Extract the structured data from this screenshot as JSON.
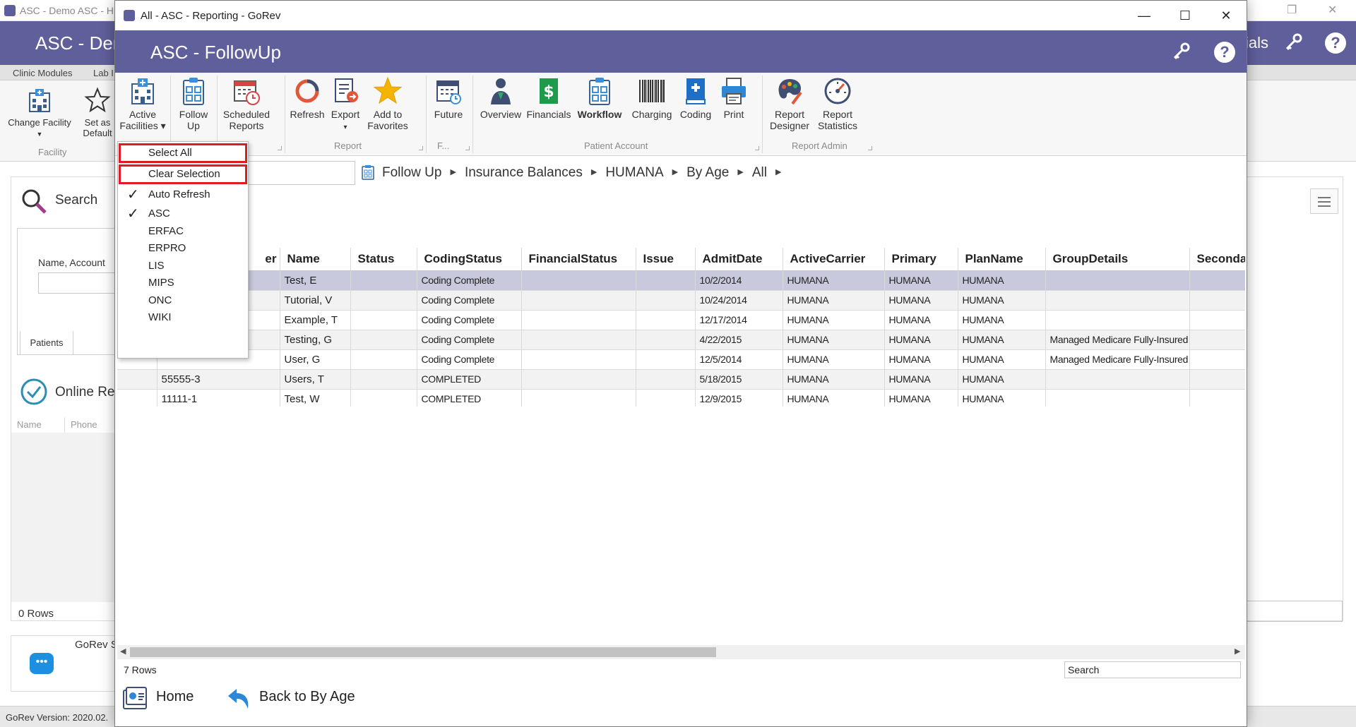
{
  "background_app": {
    "title": "ASC - Demo ASC - H",
    "brand": "ASC - Der",
    "right_text": "ials",
    "menubar": [
      "Clinic Modules",
      "Lab I"
    ],
    "ribbon": {
      "change_facility": "Change Facility",
      "set_as_default_1": "Set as",
      "set_as_default_2": "Default",
      "group_facility": "Facility"
    },
    "left_panel": {
      "search": "Search",
      "name_label": "Name, Account",
      "patients_tab": "Patients",
      "online": "Online Re",
      "col_name": "Name",
      "col_phone": "Phone",
      "rows": "0 Rows"
    },
    "chat_label": "GoRev S",
    "version": "GoRev Version: 2020.02."
  },
  "window": {
    "title": "All - ASC - Reporting - GoRev",
    "minimize": "—",
    "maximize": "☐",
    "close": "✕"
  },
  "header": {
    "brand": "ASC - FollowUp"
  },
  "ribbon": {
    "active_facilities_1": "Active",
    "active_facilities_2": "Facilities ▾",
    "follow_up_1": "Follow",
    "follow_up_2": "Up",
    "scheduled_reports_1": "Scheduled",
    "scheduled_reports_2": "Reports",
    "refresh": "Refresh",
    "export": "Export",
    "export_arrow": "▾",
    "add_fav_1": "Add to",
    "add_fav_2": "Favorites",
    "future": "Future",
    "overview": "Overview",
    "financials": "Financials",
    "workflow": "Workflow",
    "charging": "Charging",
    "coding": "Coding",
    "print": "Print",
    "report_designer_1": "Report",
    "report_designer_2": "Designer",
    "report_statistics_1": "Report",
    "report_statistics_2": "Statistics",
    "group_report": "Report",
    "group_f": "F...",
    "group_patient_account": "Patient Account",
    "group_report_admin": "Report Admin"
  },
  "breadcrumb": [
    "Follow Up",
    "Insurance Balances",
    "HUMANA",
    "By Age",
    "All"
  ],
  "dropdown": {
    "select_all": "Select All",
    "clear_selection": "Clear Selection",
    "auto_refresh": "Auto Refresh",
    "check": "✓",
    "facilities": [
      "ASC",
      "ERFAC",
      "ERPRO",
      "LIS",
      "MIPS",
      "ONC",
      "WIKI"
    ]
  },
  "grid": {
    "columns": [
      "er",
      "Name",
      "Status",
      "CodingStatus",
      "FinancialStatus",
      "Issue",
      "AdmitDate",
      "ActiveCarrier",
      "Primary",
      "PlanName",
      "GroupDetails",
      "Secondary"
    ],
    "rows": [
      [
        "",
        "Test, E",
        "",
        "Coding Complete",
        "",
        "",
        "10/2/2014",
        "HUMANA",
        "HUMANA",
        "HUMANA",
        "",
        ""
      ],
      [
        "",
        "Tutorial, V",
        "",
        "Coding Complete",
        "",
        "",
        "10/24/2014",
        "HUMANA",
        "HUMANA",
        "HUMANA",
        "",
        ""
      ],
      [
        "",
        "Example, T",
        "",
        "Coding Complete",
        "",
        "",
        "12/17/2014",
        "HUMANA",
        "HUMANA",
        "HUMANA",
        "",
        ""
      ],
      [
        "",
        "Testing, G",
        "",
        "Coding Complete",
        "",
        "",
        "4/22/2015",
        "HUMANA",
        "HUMANA",
        "HUMANA",
        "Managed Medicare Fully-Insured",
        ""
      ],
      [
        "",
        "User, G",
        "",
        "Coding Complete",
        "",
        "",
        "12/5/2014",
        "HUMANA",
        "HUMANA",
        "HUMANA",
        "Managed Medicare Fully-Insured",
        ""
      ],
      [
        "55555-3",
        "Users, T",
        "",
        "COMPLETED",
        "",
        "",
        "5/18/2015",
        "HUMANA",
        "HUMANA",
        "HUMANA",
        "",
        ""
      ],
      [
        "11111-1",
        "Test, W",
        "",
        "COMPLETED",
        "",
        "",
        "12/9/2015",
        "HUMANA",
        "HUMANA",
        "HUMANA",
        "",
        ""
      ]
    ],
    "rows_count": "7 Rows",
    "search_placeholder": "Search"
  },
  "footer": {
    "home": "Home",
    "back": "Back to By Age"
  },
  "colors": {
    "header_bg": "#5f5f9b",
    "selected_row": "#c9c9dd",
    "highlight_border": "#e01b24"
  }
}
